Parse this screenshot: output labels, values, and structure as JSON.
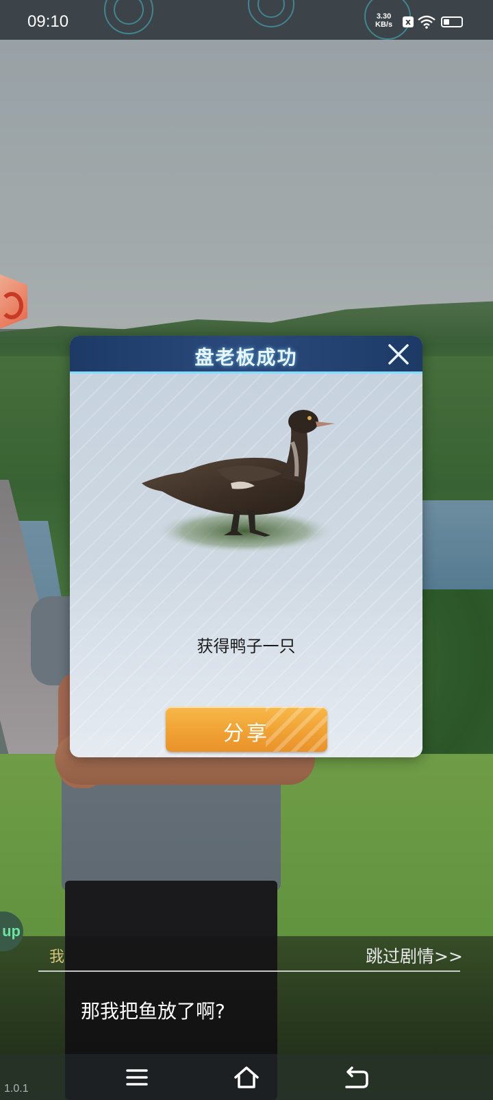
{
  "status_bar": {
    "time": "09:10",
    "net_speed_value": "3.30",
    "net_speed_unit": "KB/s",
    "sim_icon": "x",
    "wifi_icon": "wifi-icon",
    "battery_icon": "battery-icon"
  },
  "dialog": {
    "title": "盘老板成功",
    "close_icon": "close-icon",
    "reward_image": "duck-image",
    "reward_caption": "获得鸭子一只",
    "share_label": "分享"
  },
  "dialogue": {
    "speaker": "我",
    "skip_label": "跳过剧情>>",
    "line": "那我把鱼放了啊?"
  },
  "app_badge": "up",
  "version": "1.0.1",
  "nav_bar": {
    "menu_icon": "menu-icon",
    "home_icon": "home-icon",
    "back_icon": "back-icon"
  },
  "colors": {
    "dialog_header": "#1d3a66",
    "accent_glow": "#7fdcff",
    "share_button": "#f0a233",
    "speaker_name": "#d4c47a"
  }
}
